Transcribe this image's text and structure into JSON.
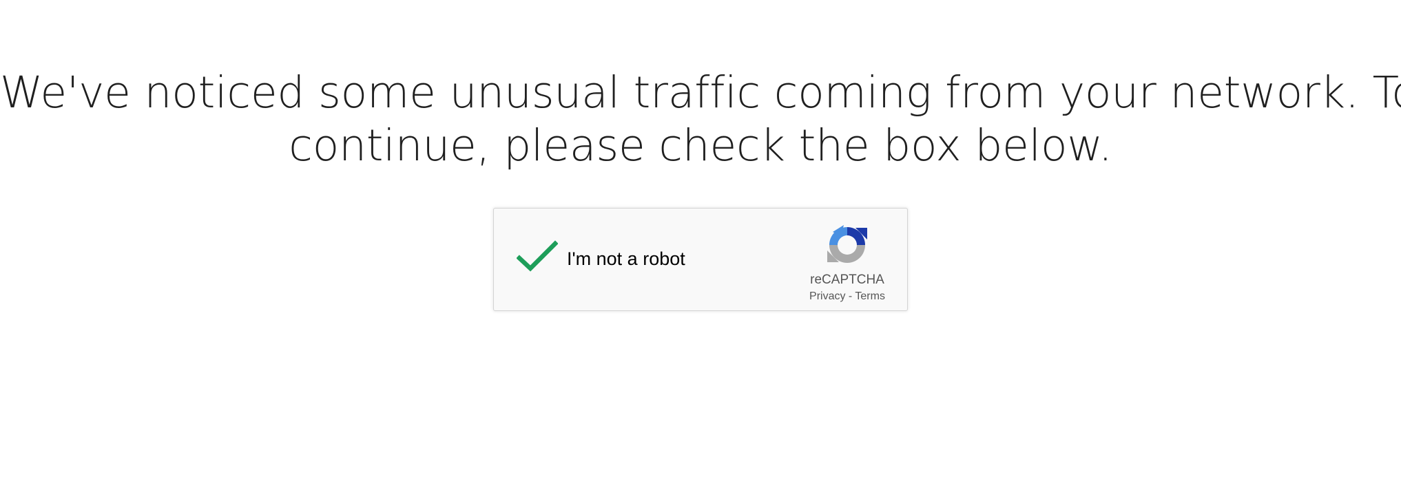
{
  "headline": {
    "line1": "We've noticed some unusual traffic coming from your network. To",
    "line2": "continue, please check the box below."
  },
  "recaptcha": {
    "checkbox_label": "I'm not a robot",
    "checked": true,
    "brand_name": "reCAPTCHA",
    "privacy_label": "Privacy",
    "separator": " - ",
    "terms_label": "Terms",
    "check_color": "#1e9e5a",
    "box_background": "#f9f9f9"
  }
}
